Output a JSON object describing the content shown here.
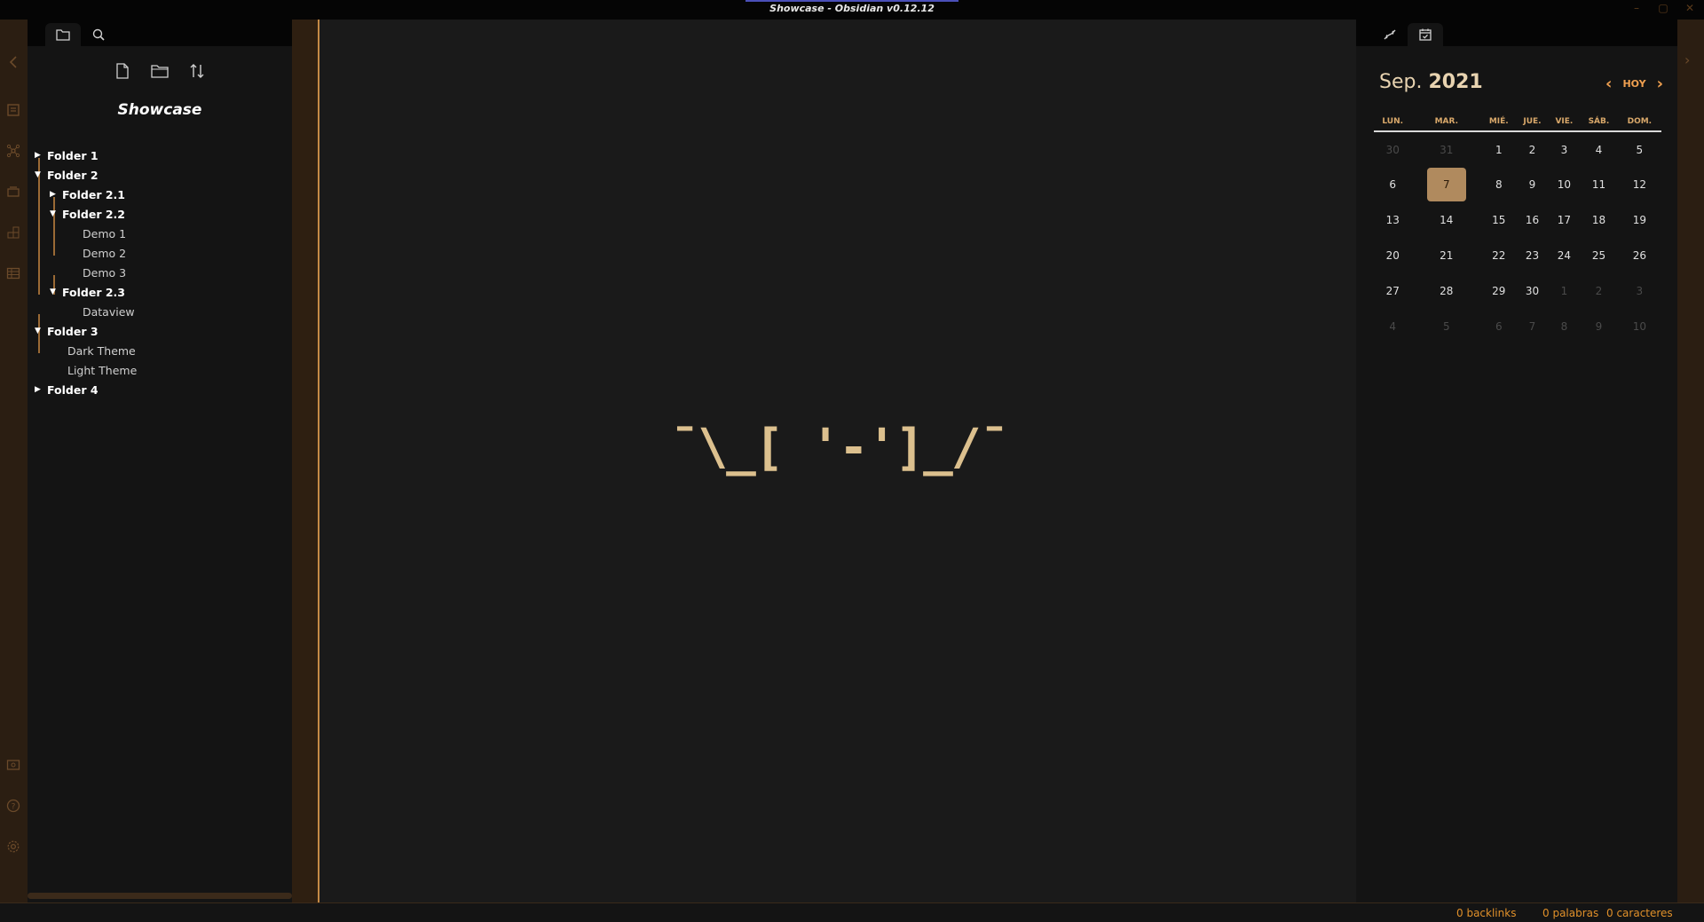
{
  "window": {
    "title": "Showcase - Obsidian v0.12.12"
  },
  "ribbon": {
    "icons": [
      "collapse-left-icon",
      "open-today-icon",
      "graph-icon",
      "templates-icon",
      "plugins-icon",
      "table-icon",
      "vault-switch-icon",
      "help-icon",
      "settings-icon"
    ]
  },
  "explorer": {
    "vault_name": "Showcase",
    "actions": [
      "new-note-icon",
      "new-folder-icon",
      "sort-icon"
    ],
    "tree": [
      {
        "label": "Folder 1",
        "type": "folder",
        "expanded": false,
        "depth": 0
      },
      {
        "label": "Folder 2",
        "type": "folder",
        "expanded": true,
        "depth": 0
      },
      {
        "label": "Folder 2.1",
        "type": "folder",
        "expanded": false,
        "depth": 1
      },
      {
        "label": "Folder 2.2",
        "type": "folder",
        "expanded": true,
        "depth": 1
      },
      {
        "label": "Demo 1",
        "type": "file",
        "depth": 2
      },
      {
        "label": "Demo 2",
        "type": "file",
        "depth": 2
      },
      {
        "label": "Demo 3",
        "type": "file",
        "depth": 2
      },
      {
        "label": "Folder 2.3",
        "type": "folder",
        "expanded": true,
        "depth": 1
      },
      {
        "label": "Dataview",
        "type": "file",
        "depth": 2
      },
      {
        "label": "Folder 3",
        "type": "folder",
        "expanded": true,
        "depth": 0
      },
      {
        "label": "Dark Theme",
        "type": "file",
        "depth": 1
      },
      {
        "label": "Light Theme",
        "type": "file",
        "depth": 1
      },
      {
        "label": "Folder 4",
        "type": "folder",
        "expanded": false,
        "depth": 0
      }
    ]
  },
  "editor": {
    "empty_text": "¯\\_[ '-']_/¯"
  },
  "calendar": {
    "month": "Sep.",
    "year": "2021",
    "today_label": "HOY",
    "weekdays": [
      "LUN.",
      "MAR.",
      "MIÉ.",
      "JUE.",
      "VIE.",
      "SÁB.",
      "DOM."
    ],
    "weeks": [
      [
        {
          "d": "30",
          "m": true
        },
        {
          "d": "31",
          "m": true
        },
        {
          "d": "1"
        },
        {
          "d": "2"
        },
        {
          "d": "3"
        },
        {
          "d": "4"
        },
        {
          "d": "5"
        }
      ],
      [
        {
          "d": "6"
        },
        {
          "d": "7",
          "t": true
        },
        {
          "d": "8"
        },
        {
          "d": "9"
        },
        {
          "d": "10"
        },
        {
          "d": "11"
        },
        {
          "d": "12"
        }
      ],
      [
        {
          "d": "13"
        },
        {
          "d": "14"
        },
        {
          "d": "15"
        },
        {
          "d": "16"
        },
        {
          "d": "17"
        },
        {
          "d": "18"
        },
        {
          "d": "19"
        }
      ],
      [
        {
          "d": "20"
        },
        {
          "d": "21"
        },
        {
          "d": "22"
        },
        {
          "d": "23"
        },
        {
          "d": "24"
        },
        {
          "d": "25"
        },
        {
          "d": "26"
        }
      ],
      [
        {
          "d": "27"
        },
        {
          "d": "28"
        },
        {
          "d": "29"
        },
        {
          "d": "30"
        },
        {
          "d": "1",
          "m": true
        },
        {
          "d": "2",
          "m": true
        },
        {
          "d": "3",
          "m": true
        }
      ],
      [
        {
          "d": "4",
          "m": true
        },
        {
          "d": "5",
          "m": true
        },
        {
          "d": "6",
          "m": true
        },
        {
          "d": "7",
          "m": true
        },
        {
          "d": "8",
          "m": true
        },
        {
          "d": "9",
          "m": true
        },
        {
          "d": "10",
          "m": true
        }
      ]
    ]
  },
  "status": {
    "backlinks": "0 backlinks",
    "words": "0 palabras",
    "chars": "0 caracteres"
  },
  "colors": {
    "accent": "#e0902a",
    "divider": "#c58a45",
    "today_bg": "#b08a5e"
  }
}
